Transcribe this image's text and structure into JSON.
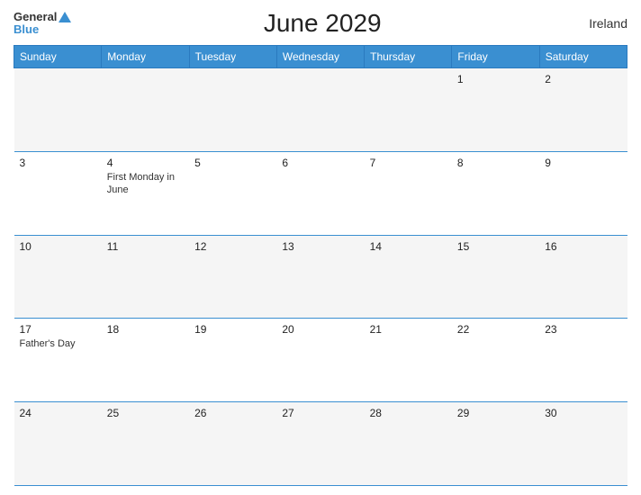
{
  "header": {
    "logo_general": "General",
    "logo_blue": "Blue",
    "title": "June 2029",
    "country": "Ireland"
  },
  "weekdays": [
    "Sunday",
    "Monday",
    "Tuesday",
    "Wednesday",
    "Thursday",
    "Friday",
    "Saturday"
  ],
  "weeks": [
    [
      {
        "day": "",
        "event": ""
      },
      {
        "day": "",
        "event": ""
      },
      {
        "day": "",
        "event": ""
      },
      {
        "day": "",
        "event": ""
      },
      {
        "day": "",
        "event": ""
      },
      {
        "day": "1",
        "event": ""
      },
      {
        "day": "2",
        "event": ""
      }
    ],
    [
      {
        "day": "3",
        "event": ""
      },
      {
        "day": "4",
        "event": "First Monday in June"
      },
      {
        "day": "5",
        "event": ""
      },
      {
        "day": "6",
        "event": ""
      },
      {
        "day": "7",
        "event": ""
      },
      {
        "day": "8",
        "event": ""
      },
      {
        "day": "9",
        "event": ""
      }
    ],
    [
      {
        "day": "10",
        "event": ""
      },
      {
        "day": "11",
        "event": ""
      },
      {
        "day": "12",
        "event": ""
      },
      {
        "day": "13",
        "event": ""
      },
      {
        "day": "14",
        "event": ""
      },
      {
        "day": "15",
        "event": ""
      },
      {
        "day": "16",
        "event": ""
      }
    ],
    [
      {
        "day": "17",
        "event": "Father's Day"
      },
      {
        "day": "18",
        "event": ""
      },
      {
        "day": "19",
        "event": ""
      },
      {
        "day": "20",
        "event": ""
      },
      {
        "day": "21",
        "event": ""
      },
      {
        "day": "22",
        "event": ""
      },
      {
        "day": "23",
        "event": ""
      }
    ],
    [
      {
        "day": "24",
        "event": ""
      },
      {
        "day": "25",
        "event": ""
      },
      {
        "day": "26",
        "event": ""
      },
      {
        "day": "27",
        "event": ""
      },
      {
        "day": "28",
        "event": ""
      },
      {
        "day": "29",
        "event": ""
      },
      {
        "day": "30",
        "event": ""
      }
    ]
  ]
}
